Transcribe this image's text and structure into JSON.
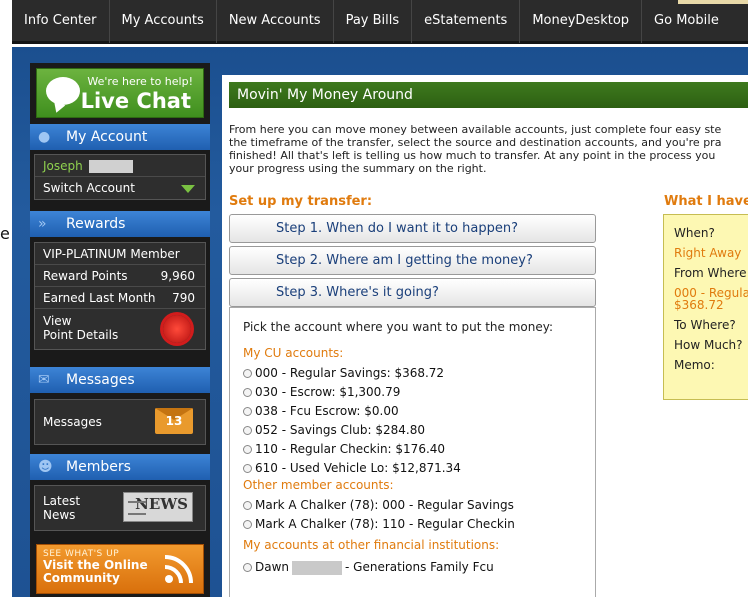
{
  "nav": {
    "items": [
      "Info Center",
      "My Accounts",
      "New Accounts",
      "Pay Bills",
      "eStatements",
      "MoneyDesktop",
      "Go Mobile"
    ]
  },
  "left_edge_char": "e",
  "sidebar": {
    "live_chat": {
      "small": "We're here to help!",
      "big": "Live Chat"
    },
    "my_account": {
      "header": "My Account",
      "user_name": "Joseph",
      "switch_label": "Switch Account"
    },
    "rewards": {
      "header": "Rewards",
      "member_level": "VIP-PLATINUM Member",
      "reward_points_label": "Reward Points",
      "reward_points_value": "9,960",
      "earned_label": "Earned Last Month",
      "earned_value": "790",
      "view_line1": "View",
      "view_line2": "Point Details"
    },
    "messages": {
      "header": "Messages",
      "label": "Messages",
      "count": "13"
    },
    "members": {
      "header": "Members",
      "news_line1": "Latest",
      "news_line2": "News",
      "news_icon_text": "NEWS"
    },
    "community": {
      "small": "SEE WHAT'S UP",
      "line1": "Visit the Online",
      "line2": "Community"
    }
  },
  "main": {
    "title": "Movin' My Money Around",
    "intro": [
      "From here you can move money between available accounts, just complete four easy ste",
      "the timeframe of the transfer, select the source and destination accounts, and you're pra",
      "finished! All that's left is telling us how much to transfer. At any point in the process you",
      "your progress using the summary on the right."
    ],
    "setup_heading": "Set up my transfer:",
    "have_heading": "What I have",
    "steps": [
      "Step 1. When do I want it to happen?",
      "Step 2. Where am I getting the money?",
      "Step 3. Where's it going?"
    ],
    "pick_prompt": "Pick the account where you want to put the money:",
    "cu_label": "My CU accounts:",
    "cu_accounts": [
      "000 - Regular Savings: $368.72",
      "030 - Escrow: $1,300.79",
      "038 - Fcu Escrow: $0.00",
      "052 - Savings Club: $284.80",
      "110 - Regular Checkin: $176.40",
      "610 - Used Vehicle Lo: $12,871.34"
    ],
    "other_label": "Other member accounts:",
    "other_accounts": [
      "Mark A Chalker (78): 000 - Regular Savings",
      "Mark A Chalker (78): 110 - Regular Checkin"
    ],
    "external_label": "My accounts at other financial institutions:",
    "external_prefix": "Dawn",
    "external_suffix": "- Generations Family Fcu"
  },
  "summary": {
    "when_label": "When?",
    "when_value": "Right Away",
    "from_label": "From Where",
    "from_value_line1": "000 - Regula",
    "from_value_line2": "$368.72",
    "to_label": "To Where?",
    "how_much_label": "How Much?",
    "memo_label": "Memo:"
  }
}
